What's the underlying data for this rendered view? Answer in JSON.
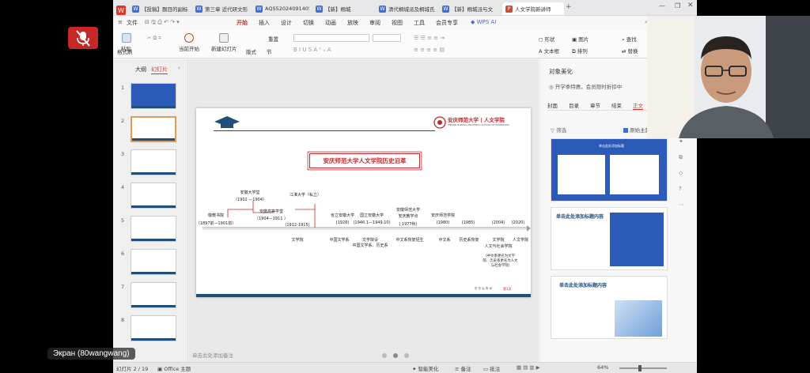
{
  "tabs": [
    {
      "label": "【投稿】题目的副标",
      "color": "#3d6fd9",
      "letter": "W"
    },
    {
      "label": "第三章 近代研文形",
      "color": "#3d6fd9",
      "letter": "W"
    },
    {
      "label": "AQS520240914056",
      "color": "#3d6fd9",
      "letter": "W"
    },
    {
      "label": "【新】桐城",
      "color": "#3d6fd9",
      "letter": "W"
    },
    {
      "label": "清代桐城派及桐城氏",
      "color": "#3d6fd9",
      "letter": "W"
    },
    {
      "label": "【新】桐城派与文",
      "color": "#3d6fd9",
      "letter": "W"
    },
    {
      "label": "人文学院新讲师",
      "color": "#d04a2e",
      "letter": "P"
    }
  ],
  "menu": {
    "file": "文件",
    "items": [
      "开始",
      "插入",
      "设计",
      "切换",
      "动画",
      "放映",
      "审阅",
      "视图",
      "工具",
      "会员专享"
    ],
    "wps_ai": "WPS AI"
  },
  "ribbon": {
    "format_brush": "格式刷",
    "paste": "粘贴",
    "play_current": "当前开始",
    "new_slide": "新建幻灯片",
    "layout": "版式",
    "section": "节",
    "reset": "重置",
    "shape": "形状",
    "image": "图片",
    "find": "查找",
    "textbox": "文本框",
    "arrange": "排列",
    "replace": "替换"
  },
  "left_panel": {
    "tab_outline": "大纲",
    "tab_slides": "幻灯片",
    "slide_numbers": [
      "1",
      "2",
      "3",
      "4",
      "5",
      "6",
      "7",
      "8"
    ]
  },
  "slide": {
    "logo_text": "安庆师范大学 | 人文学院",
    "logo_sub": "ANQING NORMAL UNIVERSITY  SCHOOL OF HUMANITIES",
    "title": "安庆师范大学人文学院历史沿革",
    "timeline": [
      {
        "name": "敬敷书院",
        "years": "（1897前—1901前）"
      },
      {
        "name": "安徽大学堂",
        "years": "（1902 —1904）"
      },
      {
        "name": "安徽高等学堂",
        "years": "（1904—1911 ）"
      },
      {
        "name": "江淮大学（私立）",
        "years": "(1912-1915)"
      },
      {
        "name": "省立安徽大学",
        "years": "(1928)"
      },
      {
        "name": "国立安徽大学",
        "years": "(1946.1—1949.10)"
      },
      {
        "name": "安徽师范大学",
        "years": ""
      },
      {
        "name": "安庆教学点",
        "years": "( 1977秋)"
      },
      {
        "name": "安庆师范学院",
        "years": "(1980)"
      },
      {
        "name": "",
        "years": "(1985)"
      },
      {
        "name": "",
        "years": "(2004)"
      },
      {
        "name": "",
        "years": "(2020)"
      }
    ],
    "below": {
      "wenxueyuan": "文学院",
      "zhongguo_wenxuexi": "中国文学系",
      "wenxueyuan2": "文学院设",
      "zhongguo_lishi": "中国文学系、历史系",
      "zhongwen_huifu": "中文系恢复招生",
      "zhongwenxi": "中文系",
      "lishixi_huifu": "历史系恢复",
      "wenxueyuan3": "文学院",
      "renwen_shehui": "人文与社会学院",
      "renwen_xueyuan": "人文学院",
      "note": "(中文系更名为文学院、历史系更名为人文与社会学院)"
    },
    "page_mark": "第1页",
    "footer_small": "伤  东  弘  鲁  尚"
  },
  "notes_placeholder": "单击此处添加备注",
  "right_panel": {
    "title": "对象美化",
    "promo": "开学季特惠，会员限时折扣中",
    "tabs": [
      "封面",
      "目录",
      "章节",
      "结束",
      "正文"
    ],
    "filter": "筛选",
    "checkbox": "原始主题",
    "card1_title": "单击此处添加标题",
    "card2_title": "单击此处添加标题内容",
    "card3_title": "单击此处添加标题内容"
  },
  "status": {
    "slide_info": "幻灯片 2 / 19",
    "theme": "Office 主题",
    "smart_beautify": "智能美化",
    "notes": "备注",
    "comments": "批注",
    "zoom": "64%"
  },
  "overlay": {
    "label": "Экран (80wangwang)"
  },
  "colors": {
    "accent_red": "#c43b2d",
    "slide_blue": "#1f4e79",
    "title_red": "#c0272d"
  }
}
